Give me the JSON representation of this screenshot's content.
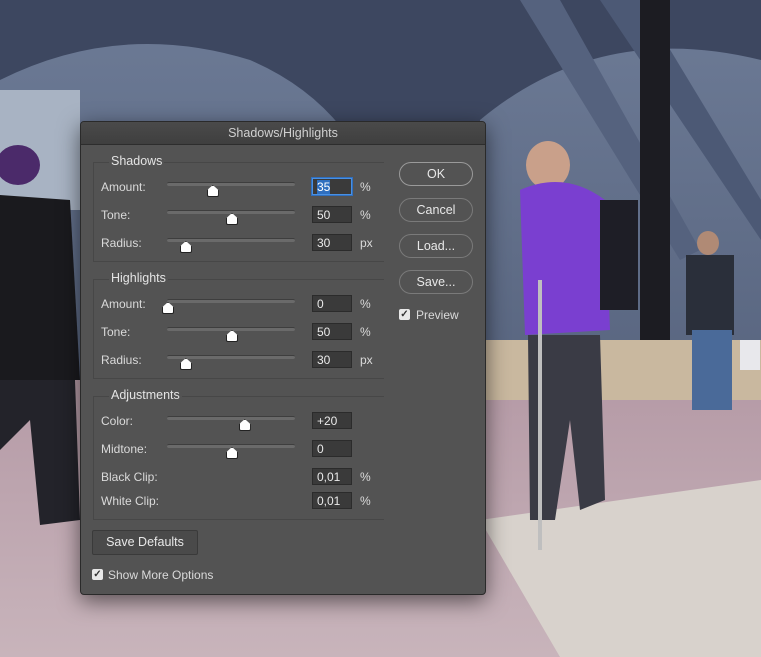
{
  "dialog": {
    "title": "Shadows/Highlights",
    "shadows": {
      "title": "Shadows",
      "rows": [
        {
          "label": "Amount:",
          "value": "35",
          "unit": "%",
          "level": 0.35
        },
        {
          "label": "Tone:",
          "value": "50",
          "unit": "%",
          "level": 0.5
        },
        {
          "label": "Radius:",
          "value": "30",
          "unit": "px",
          "level": 0.14
        }
      ]
    },
    "highlights": {
      "title": "Highlights",
      "rows": [
        {
          "label": "Amount:",
          "value": "0",
          "unit": "%",
          "level": 0.0
        },
        {
          "label": "Tone:",
          "value": "50",
          "unit": "%",
          "level": 0.5
        },
        {
          "label": "Radius:",
          "value": "30",
          "unit": "px",
          "level": 0.14
        }
      ]
    },
    "adjustments": {
      "title": "Adjustments",
      "rows": [
        {
          "label": "Color:",
          "value": "+20",
          "unit": "",
          "level": 0.6
        },
        {
          "label": "Midtone:",
          "value": "0",
          "unit": "",
          "level": 0.5
        },
        {
          "label": "Black Clip:",
          "value": "0,01",
          "unit": "%"
        },
        {
          "label": "White Clip:",
          "value": "0,01",
          "unit": "%"
        }
      ]
    },
    "buttons": {
      "ok": "OK",
      "cancel": "Cancel",
      "load": "Load...",
      "save": "Save...",
      "save_defaults": "Save Defaults"
    },
    "preview": {
      "label": "Preview",
      "checked": true
    },
    "show_more_options": {
      "label": "Show More Options",
      "checked": true
    }
  },
  "colors": {
    "dialog_bg": "#535353",
    "focus_blue": "#2f6fbf",
    "jacket_purple": "#7a3fd0"
  }
}
